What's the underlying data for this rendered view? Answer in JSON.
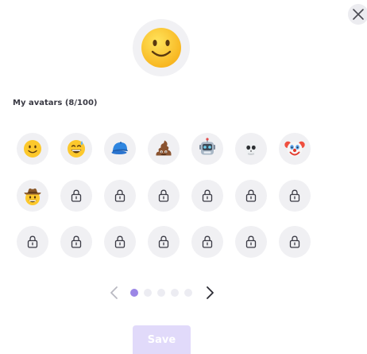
{
  "preview": {
    "icon": "slightly-smiling-face-icon"
  },
  "section_title": "My avatars (8/100)",
  "avatars": [
    {
      "icon": "slightly-smiling-face-icon",
      "unlocked": true
    },
    {
      "icon": "grinning-sweat-face-icon",
      "unlocked": true
    },
    {
      "icon": "blue-cap-icon",
      "unlocked": true
    },
    {
      "icon": "pile-of-poo-icon",
      "unlocked": true
    },
    {
      "icon": "robot-face-icon",
      "unlocked": true
    },
    {
      "icon": "skull-icon",
      "unlocked": true
    },
    {
      "icon": "clown-face-icon",
      "unlocked": true
    },
    {
      "icon": "cowboy-face-icon",
      "unlocked": true
    },
    {
      "icon": "lock-icon",
      "unlocked": false
    },
    {
      "icon": "lock-icon",
      "unlocked": false
    },
    {
      "icon": "lock-icon",
      "unlocked": false
    },
    {
      "icon": "lock-icon",
      "unlocked": false
    },
    {
      "icon": "lock-icon",
      "unlocked": false
    },
    {
      "icon": "lock-icon",
      "unlocked": false
    },
    {
      "icon": "lock-icon",
      "unlocked": false
    },
    {
      "icon": "lock-icon",
      "unlocked": false
    },
    {
      "icon": "lock-icon",
      "unlocked": false
    },
    {
      "icon": "lock-icon",
      "unlocked": false
    },
    {
      "icon": "lock-icon",
      "unlocked": false
    },
    {
      "icon": "lock-icon",
      "unlocked": false
    },
    {
      "icon": "lock-icon",
      "unlocked": false
    }
  ],
  "pagination": {
    "pages": 5,
    "current": 1
  },
  "save_label": "Save",
  "colors": {
    "accent": "#9b86e6",
    "save_disabled_bg": "#e1dafa",
    "tile_bg": "#f0f0f3"
  }
}
